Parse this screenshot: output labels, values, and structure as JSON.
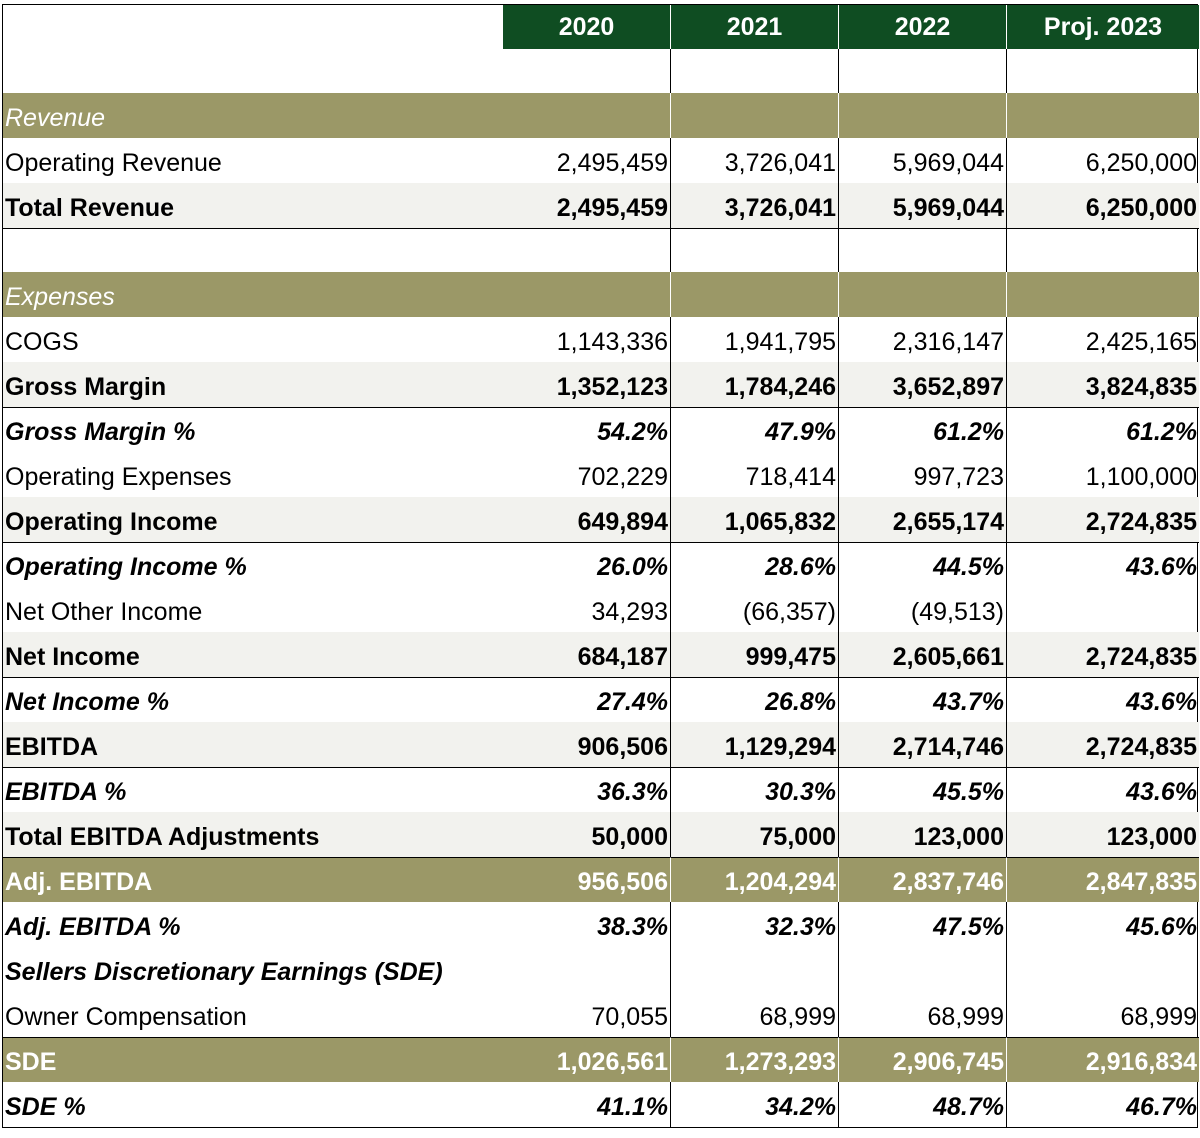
{
  "header": {
    "years": [
      "2020",
      "2021",
      "2022",
      "Proj. 2023"
    ]
  },
  "rows": [
    {
      "kind": "section",
      "label": "Revenue",
      "values": [
        "",
        "",
        "",
        ""
      ]
    },
    {
      "kind": "normal",
      "label": "Operating Revenue",
      "values": [
        "2,495,459",
        "3,726,041",
        "5,969,044",
        "6,250,000"
      ]
    },
    {
      "kind": "total",
      "label": "Total Revenue",
      "values": [
        "2,495,459",
        "3,726,041",
        "5,969,044",
        "6,250,000"
      ]
    },
    {
      "kind": "blank",
      "label": "",
      "values": [
        "",
        "",
        "",
        ""
      ]
    },
    {
      "kind": "section",
      "label": "Expenses",
      "values": [
        "",
        "",
        "",
        ""
      ]
    },
    {
      "kind": "normal",
      "label": "COGS",
      "values": [
        "1,143,336",
        "1,941,795",
        "2,316,147",
        "2,425,165"
      ]
    },
    {
      "kind": "total",
      "label": "Gross Margin",
      "values": [
        "1,352,123",
        "1,784,246",
        "3,652,897",
        "3,824,835"
      ]
    },
    {
      "kind": "pct",
      "label": "Gross Margin %",
      "values": [
        "54.2%",
        "47.9%",
        "61.2%",
        "61.2%"
      ]
    },
    {
      "kind": "normal",
      "label": "Operating Expenses",
      "values": [
        "702,229",
        "718,414",
        "997,723",
        "1,100,000"
      ]
    },
    {
      "kind": "total",
      "label": "Operating Income",
      "values": [
        "649,894",
        "1,065,832",
        "2,655,174",
        "2,724,835"
      ]
    },
    {
      "kind": "pct",
      "label": "Operating Income %",
      "values": [
        "26.0%",
        "28.6%",
        "44.5%",
        "43.6%"
      ]
    },
    {
      "kind": "normal",
      "label": "Net Other Income",
      "values": [
        "34,293",
        "(66,357)",
        "(49,513)",
        ""
      ]
    },
    {
      "kind": "total",
      "label": "Net Income",
      "values": [
        "684,187",
        "999,475",
        "2,605,661",
        "2,724,835"
      ]
    },
    {
      "kind": "pct",
      "label": "Net Income %",
      "values": [
        "27.4%",
        "26.8%",
        "43.7%",
        "43.6%"
      ]
    },
    {
      "kind": "total",
      "label": "EBITDA",
      "values": [
        "906,506",
        "1,129,294",
        "2,714,746",
        "2,724,835"
      ]
    },
    {
      "kind": "pct",
      "label": "EBITDA %",
      "values": [
        "36.3%",
        "30.3%",
        "45.5%",
        "43.6%"
      ]
    },
    {
      "kind": "total",
      "label": "Total EBITDA Adjustments",
      "values": [
        "50,000",
        "75,000",
        "123,000",
        "123,000"
      ]
    },
    {
      "kind": "highlight",
      "label": "Adj. EBITDA",
      "values": [
        "956,506",
        "1,204,294",
        "2,837,746",
        "2,847,835"
      ]
    },
    {
      "kind": "pct-plain",
      "label": "Adj. EBITDA %",
      "values": [
        "38.3%",
        "32.3%",
        "47.5%",
        "45.6%"
      ]
    },
    {
      "kind": "subhead",
      "label": "Sellers Discretionary Earnings (SDE)",
      "values": [
        "",
        "",
        "",
        ""
      ]
    },
    {
      "kind": "normal-plain",
      "label": "Owner Compensation",
      "values": [
        "70,055",
        "68,999",
        "68,999",
        "68,999"
      ]
    },
    {
      "kind": "highlight",
      "label": "SDE",
      "values": [
        "1,026,561",
        "1,273,293",
        "2,906,745",
        "2,916,834"
      ]
    },
    {
      "kind": "pct-plain",
      "label": "SDE %",
      "values": [
        "41.1%",
        "34.2%",
        "48.7%",
        "46.7%"
      ]
    }
  ]
}
